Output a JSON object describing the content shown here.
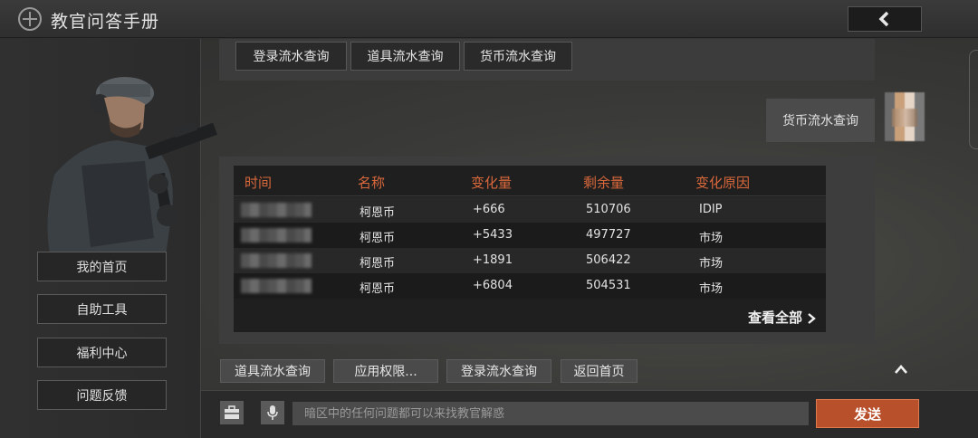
{
  "header": {
    "title": "教官问答手册",
    "back_icon": "chevron-left-icon"
  },
  "sidebar": {
    "items": [
      {
        "label": "我的首页"
      },
      {
        "label": "自助工具"
      },
      {
        "label": "福利中心"
      },
      {
        "label": "问题反馈"
      }
    ]
  },
  "top_menu": {
    "items": [
      {
        "label": "登录流水查询"
      },
      {
        "label": "道具流水查询"
      },
      {
        "label": "货币流水查询"
      }
    ]
  },
  "user_message": {
    "text": "货币流水查询"
  },
  "table": {
    "columns": [
      "时间",
      "名称",
      "变化量",
      "剩余量",
      "变化原因"
    ],
    "rows": [
      {
        "name": "柯恩币",
        "change": "+666",
        "remaining": "510706",
        "reason": "IDIP"
      },
      {
        "name": "柯恩币",
        "change": "+5433",
        "remaining": "497727",
        "reason": "市场"
      },
      {
        "name": "柯恩币",
        "change": "+1891",
        "remaining": "506422",
        "reason": "市场"
      },
      {
        "name": "柯恩币",
        "change": "+6804",
        "remaining": "504531",
        "reason": "市场"
      }
    ],
    "view_all": "查看全部"
  },
  "quick_actions": [
    {
      "label": "道具流水查询"
    },
    {
      "label": "应用权限..."
    },
    {
      "label": "登录流水查询"
    },
    {
      "label": "返回首页"
    }
  ],
  "input": {
    "placeholder": "暗区中的任何问题都可以来找教官解惑",
    "send_label": "发送"
  },
  "colors": {
    "accent": "#b9502c",
    "header_text": "#d9683b"
  }
}
